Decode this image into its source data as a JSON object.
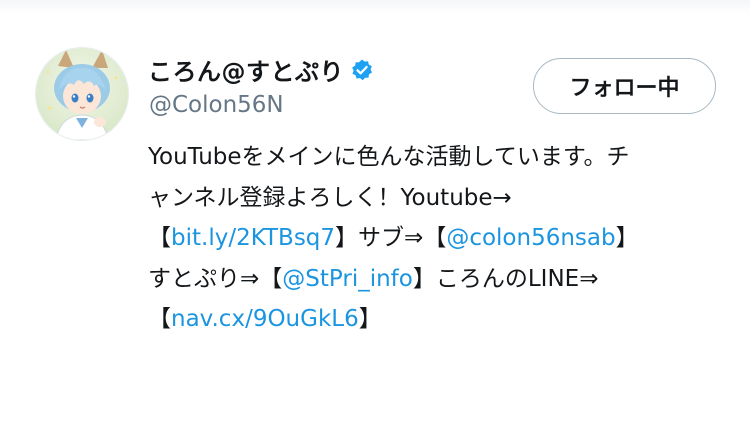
{
  "profile": {
    "display_name": "ころん@すとぷり",
    "handle": "@Colon56N",
    "follow_button_label": "フォロー中",
    "icons": {
      "verified": "verified-badge-icon",
      "avatar": "anime-avatar-image"
    },
    "colors": {
      "link": "#1b95e0",
      "verified": "#1da1f2",
      "handle": "#657786"
    }
  },
  "bio": {
    "l1": "YouTubeをメインに色んな活動しています。チ",
    "l2": "ャンネル登録よろしく！Youtube→",
    "l3_open": "【",
    "l3_link1": "bit.ly/2KTBsq7",
    "l3_mid": "】サブ⇒【",
    "l3_link2": "@colon56nsab",
    "l3_close": "】",
    "l4_pre": "すとぷり⇒【",
    "l4_link": "@StPri_info",
    "l4_post": "】ころんのLINE⇒",
    "l5_open": "【",
    "l5_link": "nav.cx/9OuGkL6",
    "l5_close": "】"
  }
}
